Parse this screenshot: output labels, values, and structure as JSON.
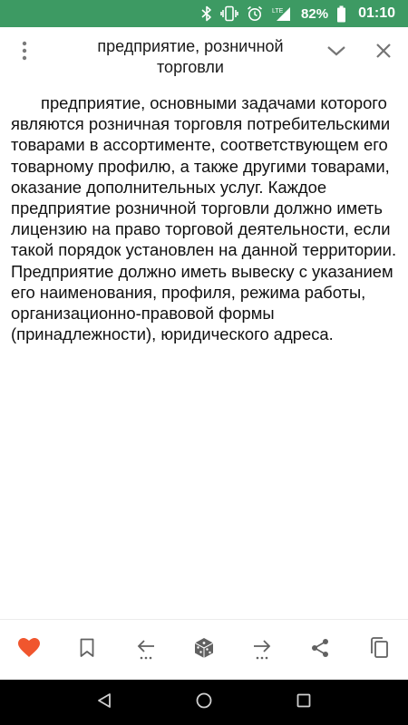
{
  "status_bar": {
    "battery_percent": "82%",
    "time": "01:10",
    "network_label": "LTE",
    "icons": [
      "bluetooth-icon",
      "vibrate-icon",
      "alarm-icon",
      "signal-icon",
      "battery-icon"
    ]
  },
  "header": {
    "title_line1": "предприятие, розничной",
    "title_line2": "торговли",
    "icons": [
      "more-vert-icon",
      "chevron-down-icon",
      "close-icon"
    ]
  },
  "article": {
    "text": "предприятие, основными задачами которого являются розничная торговля потребительскими товарами в ассортименте, соответствующем его товарному профилю, а также другими товарами, оказание дополнительных услуг. Каждое предприятие розничной торговли должно иметь лицензию на право торговой деятельности, если такой порядок установлен на данной территории. Предприятие должно иметь вывеску с указанием его наименования, профиля, режима работы, организационно-правовой формы (принадлежности), юридического адреса."
  },
  "toolbar": {
    "buttons": [
      "heart-icon",
      "bookmark-icon",
      "arrow-left-icon",
      "dice-icon",
      "arrow-right-icon",
      "share-icon",
      "copy-icon"
    ],
    "accent_color": "#f0562e"
  },
  "nav_bar": {
    "buttons": [
      "back-icon",
      "home-icon",
      "recents-icon"
    ]
  },
  "colors": {
    "status_bar": "#3d9a63",
    "heart": "#f0562e",
    "icon_gray": "#757575"
  }
}
